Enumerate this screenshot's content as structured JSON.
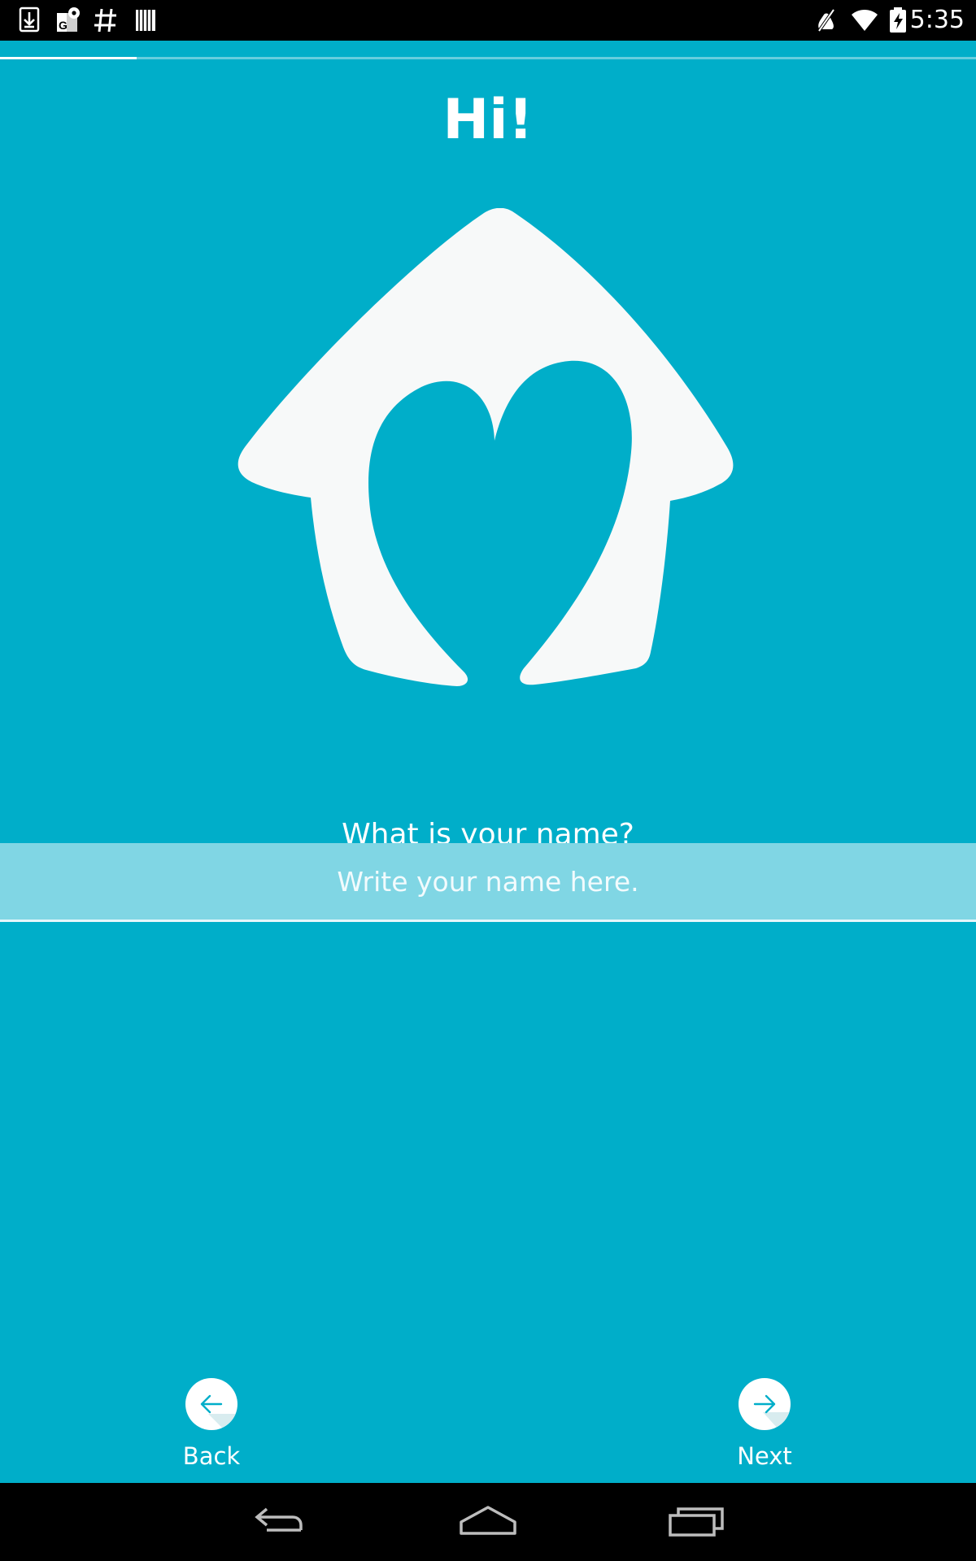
{
  "status_bar": {
    "time": "5:35",
    "left_icons": [
      "download-icon",
      "maps-notification-icon",
      "hash-icon",
      "barcode-icon"
    ],
    "right_icons": [
      "mute-icon",
      "wifi-icon",
      "battery-charging-icon"
    ]
  },
  "onboarding": {
    "progress": 0.14,
    "title": "Hi!",
    "question": "What is your name?",
    "name_input": {
      "value": "",
      "placeholder": "Write your name here."
    },
    "back_label": "Back",
    "next_label": "Next"
  },
  "system_nav": {
    "buttons": [
      "back-nav-icon",
      "home-nav-icon",
      "recent-apps-icon"
    ]
  },
  "colors": {
    "background": "#00aec9",
    "logo": "#f7f9f9",
    "input_background": "#80d6e4"
  }
}
